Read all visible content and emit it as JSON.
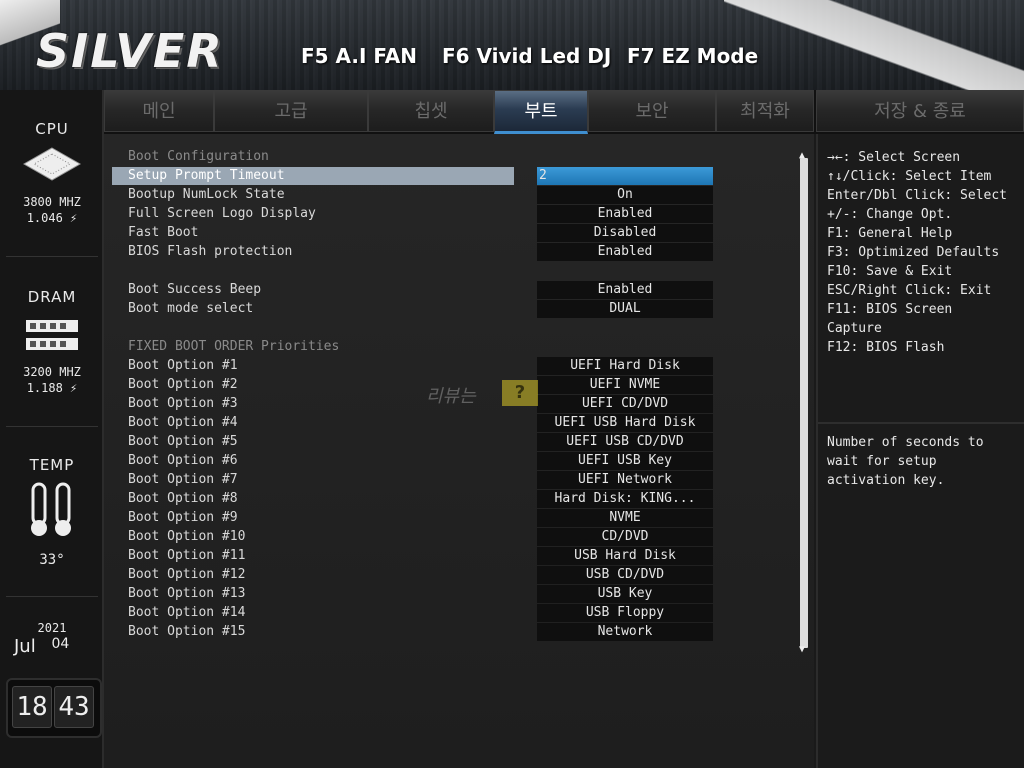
{
  "header": {
    "logo": "SILVER",
    "hotkeys": [
      "F5 A.I FAN",
      "F6 Vivid Led DJ",
      "F7 EZ Mode"
    ]
  },
  "tabs": [
    {
      "label": "메인",
      "active": false
    },
    {
      "label": "고급",
      "active": false
    },
    {
      "label": "칩셋",
      "active": false
    },
    {
      "label": "부트",
      "active": true
    },
    {
      "label": "보안",
      "active": false
    },
    {
      "label": "최적화",
      "active": false
    },
    {
      "label": "저장 & 종료",
      "active": false
    }
  ],
  "sidebar": {
    "cpu": {
      "title": "CPU",
      "freq": "3800 MHZ",
      "volt": "1.046 ⚡"
    },
    "dram": {
      "title": "DRAM",
      "freq": "3200 MHZ",
      "volt": "1.188 ⚡"
    },
    "temp": {
      "title": "TEMP",
      "value": "33°"
    },
    "date": {
      "year": "2021",
      "month": "Jul",
      "day": "04"
    },
    "clock": {
      "hours": "18",
      "minutes": "43"
    }
  },
  "main": {
    "section_boot_config": "Boot Configuration",
    "settings": [
      {
        "label": "Setup Prompt Timeout",
        "value": "2"
      },
      {
        "label": "Bootup NumLock State",
        "value": "On"
      },
      {
        "label": "Full Screen Logo Display",
        "value": "Enabled"
      },
      {
        "label": "Fast Boot",
        "value": "Disabled"
      },
      {
        "label": "BIOS Flash protection",
        "value": "Enabled"
      }
    ],
    "settings2": [
      {
        "label": "Boot Success Beep",
        "value": "Enabled"
      },
      {
        "label": "Boot mode select",
        "value": "DUAL"
      }
    ],
    "section_fixed": "FIXED BOOT ORDER Priorities",
    "boot_options": [
      {
        "label": "Boot Option #1",
        "value": "UEFI Hard Disk"
      },
      {
        "label": "Boot Option #2",
        "value": "UEFI NVME"
      },
      {
        "label": "Boot Option #3",
        "value": "UEFI CD/DVD"
      },
      {
        "label": "Boot Option #4",
        "value": "UEFI USB Hard Disk"
      },
      {
        "label": "Boot Option #5",
        "value": "UEFI USB CD/DVD"
      },
      {
        "label": "Boot Option #6",
        "value": "UEFI USB Key"
      },
      {
        "label": "Boot Option #7",
        "value": "UEFI Network"
      },
      {
        "label": "Boot Option #8",
        "value": "Hard Disk: KING..."
      },
      {
        "label": "Boot Option #9",
        "value": "NVME"
      },
      {
        "label": "Boot Option #10",
        "value": "CD/DVD"
      },
      {
        "label": "Boot Option #11",
        "value": "USB Hard Disk"
      },
      {
        "label": "Boot Option #12",
        "value": "USB CD/DVD"
      },
      {
        "label": "Boot Option #13",
        "value": "USB Key"
      },
      {
        "label": "Boot Option #14",
        "value": "USB Floppy"
      },
      {
        "label": "Boot Option #15",
        "value": "Network"
      }
    ],
    "watermark": "리뷰는"
  },
  "help": {
    "keys": [
      "→←: Select Screen",
      "↑↓/Click: Select Item",
      "Enter/Dbl Click: Select",
      "+/-: Change Opt.",
      "F1: General Help",
      "F3: Optimized Defaults",
      "F10: Save & Exit",
      "ESC/Right Click: Exit",
      "F11: BIOS Screen",
      "Capture",
      "F12: BIOS Flash"
    ],
    "description": [
      "Number of seconds to",
      "wait for setup",
      "activation key."
    ]
  },
  "colors": {
    "accent_blue": "#1e76b4",
    "selected_row": "#9aa7b4",
    "value_bg": "#0f0f0f"
  }
}
